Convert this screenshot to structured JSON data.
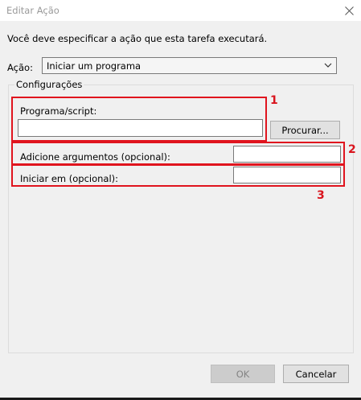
{
  "window": {
    "title": "Editar Ação"
  },
  "instruction": "Você deve especificar a ação que esta tarefa executará.",
  "action": {
    "label": "Ação:",
    "selected": "Iniciar um programa"
  },
  "settings": {
    "legend": "Configurações",
    "program_label": "Programa/script:",
    "program_value": "",
    "browse_label": "Procurar...",
    "args_label": "Adicione argumentos (opcional):",
    "args_value": "",
    "start_label": "Iniciar em (opcional):",
    "start_value": ""
  },
  "annotations": {
    "n1": "1",
    "n2": "2",
    "n3": "3",
    "color": "#e0141e"
  },
  "buttons": {
    "ok": "OK",
    "cancel": "Cancelar"
  }
}
